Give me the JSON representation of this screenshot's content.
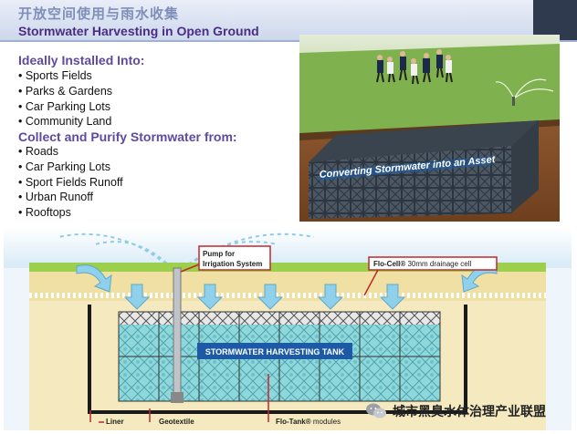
{
  "header": {
    "title_cn": "开放空间使用与雨水收集",
    "title_en": "Stormwater Harvesting in Open Ground"
  },
  "left_panel": {
    "installed_heading": "Ideally Installed Into:",
    "installed_items": [
      "• Sports Fields",
      "• Parks & Gardens",
      "• Car Parking Lots",
      "• Community Land"
    ],
    "collect_heading": "Collect and Purify Stormwater from:",
    "collect_items": [
      "• Roads",
      "• Car Parking Lots",
      "• Sport Fields Runoff",
      "• Urban Runoff",
      "• Rooftops"
    ]
  },
  "photo": {
    "banner": "Converting Stormwater into an Asset"
  },
  "diagram": {
    "pump_label_1": "Pump for",
    "pump_label_2": "Irrigation System",
    "flo_cell_bold": "Flo-Cell®",
    "flo_cell_rest": " 30mm drainage cell",
    "tank_label": "STORMWATER HARVESTING TANK",
    "liner": "Liner",
    "geotextile": "Geotextile",
    "flo_tank_bold": "Flo-Tank®",
    "flo_tank_rest": " modules"
  },
  "watermark": {
    "text": "城市黑臭水体治理产业联盟"
  },
  "colors": {
    "title_purple": "#4b2c82",
    "heading_purple": "#5e4aa0",
    "water_teal": "#7ccfd3",
    "arrow_blue": "#8fd0ea",
    "label_red": "#c0282d",
    "tank_label_bg": "#1c5aa8"
  }
}
